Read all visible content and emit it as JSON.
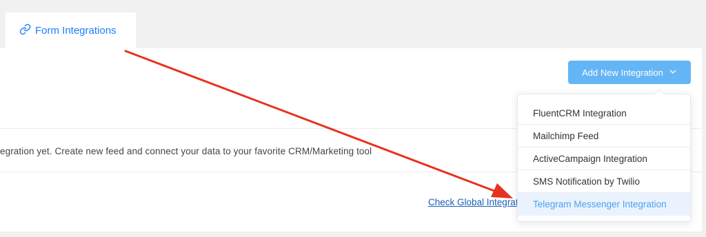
{
  "tabs": {
    "form_integrations": "Form Integrations"
  },
  "toolbar": {
    "add_new_label": "Add New Integration"
  },
  "empty_state": {
    "message": "egration yet. Create new feed and connect your data to your favorite CRM/Marketing tool"
  },
  "links": {
    "check_global": "Check Global Integrations"
  },
  "dropdown": {
    "items": [
      "FluentCRM Integration",
      "Mailchimp Feed",
      "ActiveCampaign Integration",
      "SMS Notification by Twilio",
      "Telegram Messenger Integration"
    ],
    "highlighted_item": "Telegram Messenger Integration"
  },
  "colors": {
    "accent": "#1a7efb",
    "button_bg": "#64b5f6",
    "annotation_arrow": "#e8321f"
  },
  "icons": {
    "tab": "link-icon",
    "button": "chevron-down-icon"
  }
}
